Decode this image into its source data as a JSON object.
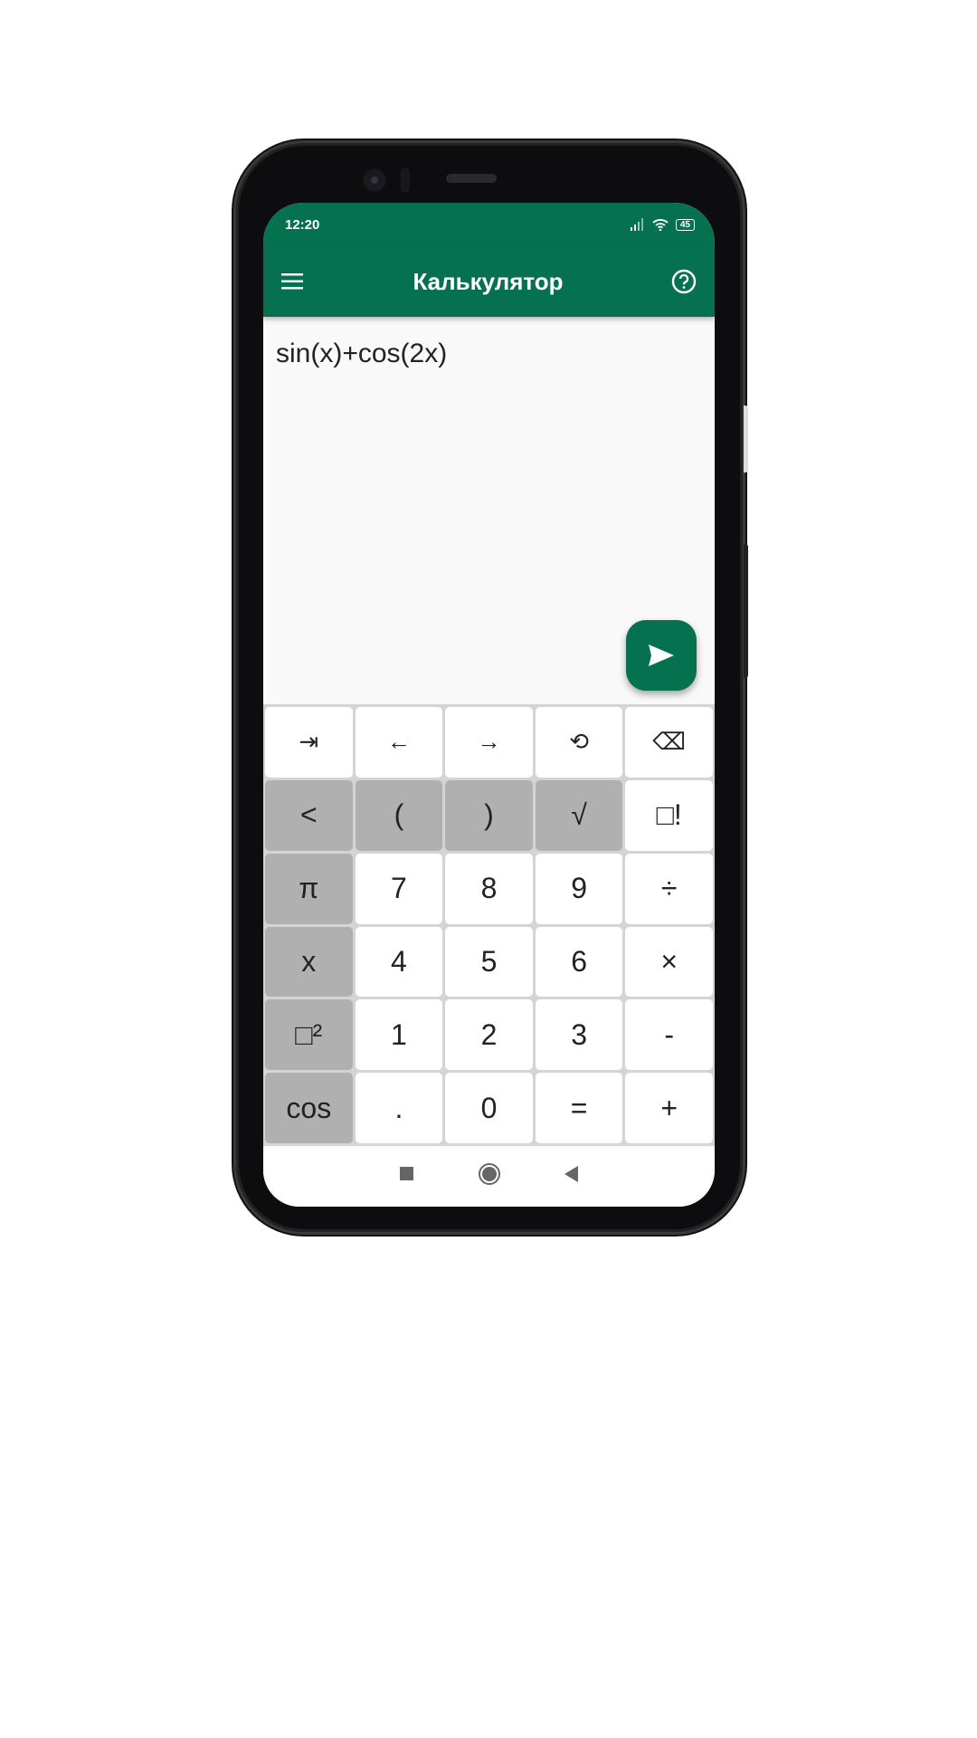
{
  "status": {
    "time": "12:20",
    "battery": "45"
  },
  "appbar": {
    "title": "Калькулятор",
    "menu_icon": "menu-icon",
    "help_icon": "help-icon"
  },
  "expression": "sin(x)+cos(2x)",
  "colors": {
    "primary": "#06714e",
    "key_gray": "#b0b0b0"
  },
  "keys": [
    [
      "⇥",
      "←",
      "→",
      "⟲",
      "⌫"
    ],
    [
      "<",
      "(",
      ")",
      "√",
      "□!"
    ],
    [
      "π",
      "7",
      "8",
      "9",
      "÷"
    ],
    [
      "x",
      "4",
      "5",
      "6",
      "×"
    ],
    [
      "□²",
      "1",
      "2",
      "3",
      "-"
    ],
    [
      "cos",
      ".",
      "0",
      "=",
      "+"
    ]
  ]
}
